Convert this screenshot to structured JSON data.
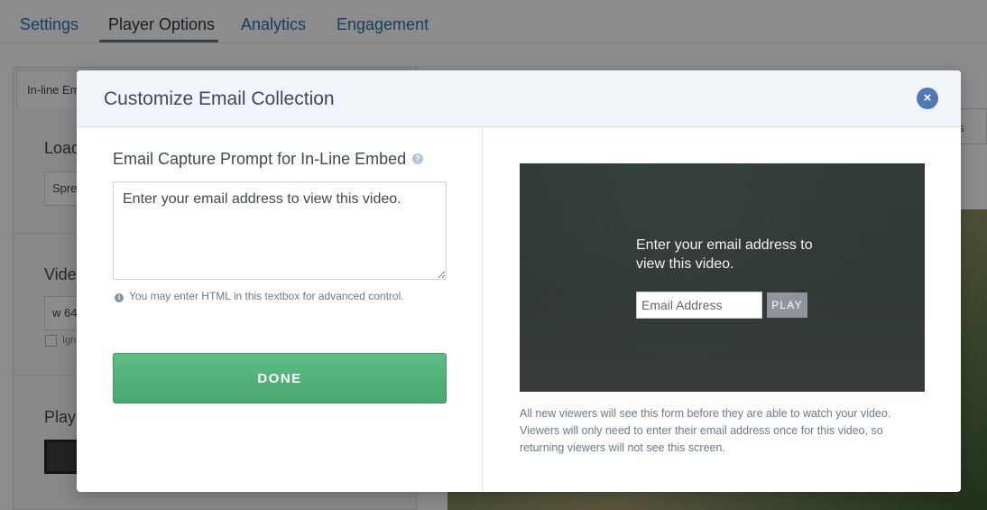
{
  "background": {
    "tabs": [
      "Settings",
      "Player Options",
      "Analytics",
      "Engagement"
    ],
    "active_tab": "Player Options",
    "subtab_label": "In-line Em",
    "label_load": "Load",
    "box_load_value": "Spre",
    "label_video": "Vide",
    "box_video_value": "w 64",
    "check_label": "Ign",
    "label_player": "Playe",
    "right_box_label": "gs"
  },
  "modal": {
    "title": "Customize Email Collection",
    "close_symbol": "×",
    "prompt_label": "Email Capture Prompt for In-Line Embed",
    "help_symbol": "?",
    "prompt_value": "Enter your email address to view this video.",
    "hint_symbol": "i",
    "hint": "You may enter HTML in this textbox for advanced control.",
    "done_label": "DONE",
    "preview": {
      "text": "Enter your email address to view this video.",
      "email_placeholder": "Email Address",
      "play_label": "PLAY"
    },
    "preview_description": "All new viewers will see this form before they are able to watch your video. Viewers will only need to enter their email address once for this video, so returning viewers will not see this screen."
  },
  "colors": {
    "accent_blue": "#4f79b5",
    "done_green": "#4fae76",
    "link_blue": "#2f6fb0"
  }
}
